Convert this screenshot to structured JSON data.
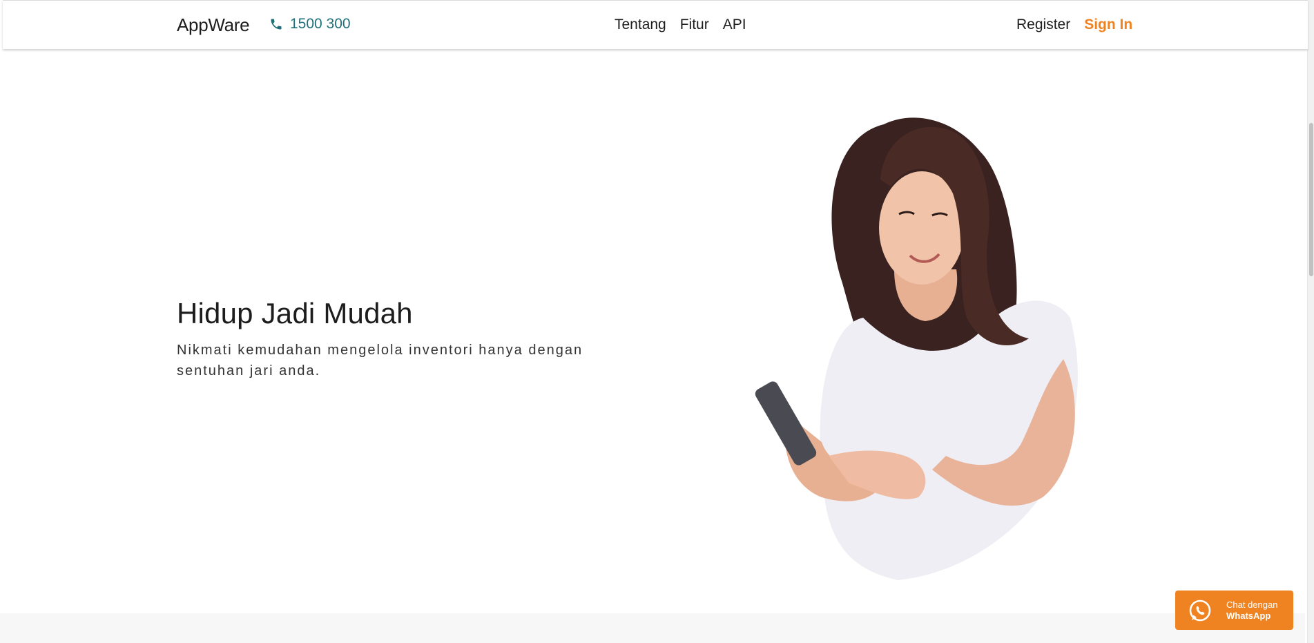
{
  "navbar": {
    "brand": "AppWare",
    "phone": "1500 300",
    "links": [
      "Tentang",
      "Fitur",
      "API"
    ],
    "register": "Register",
    "sign_in": "Sign In"
  },
  "hero": {
    "title": "Hidup Jadi Mudah",
    "subtitle": "Nikmati kemudahan mengelola inventori hanya dengan sentuhan jari anda."
  },
  "whatsapp": {
    "line1": "Chat dengan",
    "line2": "WhatsApp"
  },
  "icons": {
    "phone": "phone-icon",
    "whatsapp": "whatsapp-icon"
  },
  "colors": {
    "accent": "#ef8322",
    "phone": "#1f6f78",
    "text": "#1d1d1d"
  }
}
